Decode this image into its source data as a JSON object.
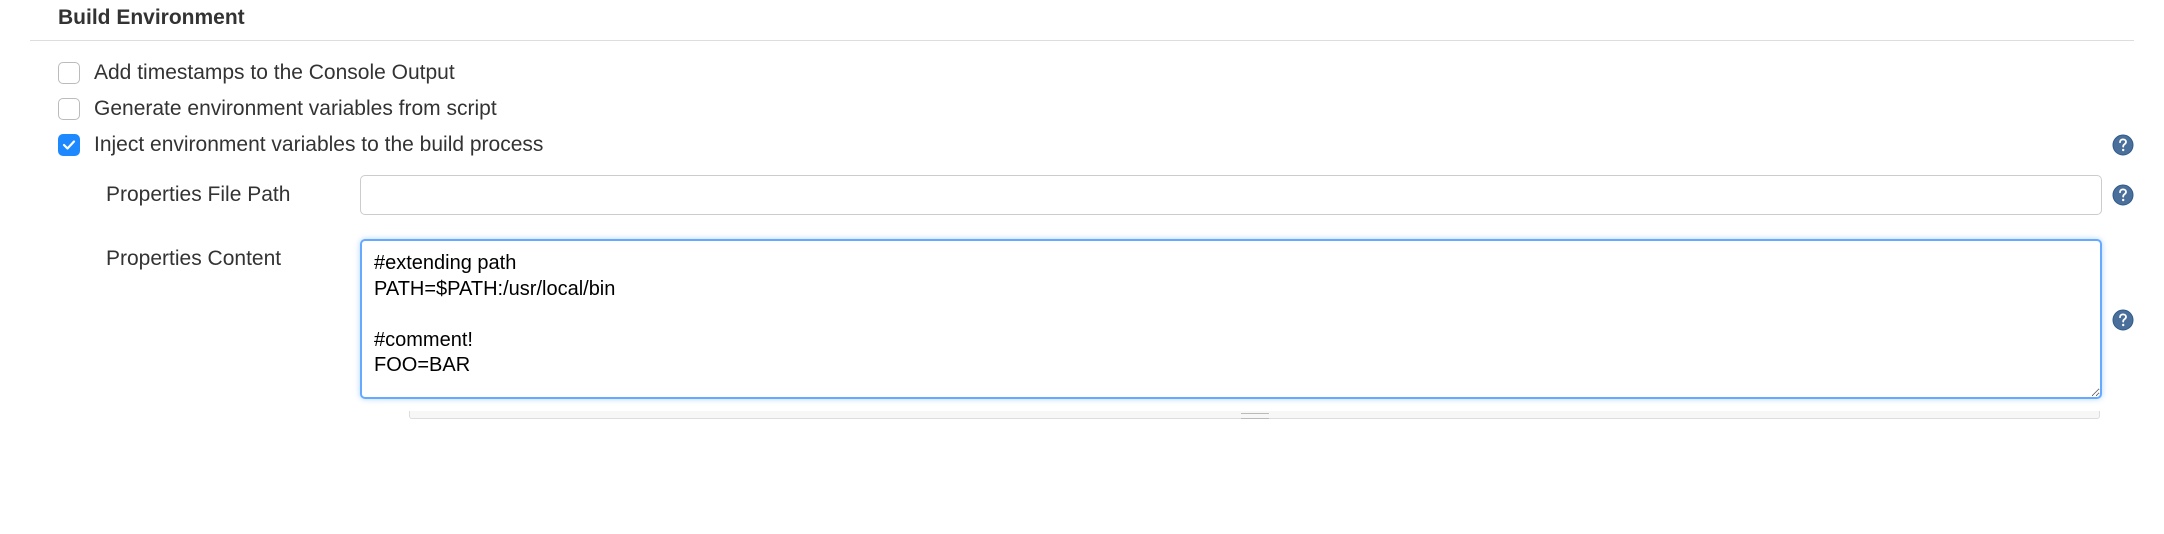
{
  "section": {
    "title": "Build Environment"
  },
  "options": {
    "timestamps": {
      "label": "Add timestamps to the Console Output",
      "checked": false
    },
    "generateEnv": {
      "label": "Generate environment variables from script",
      "checked": false
    },
    "injectEnv": {
      "label": "Inject environment variables to the build process",
      "checked": true
    }
  },
  "fields": {
    "propertiesFilePath": {
      "label": "Properties File Path",
      "value": ""
    },
    "propertiesContent": {
      "label": "Properties Content",
      "value": "#extending path\nPATH=$PATH:/usr/local/bin\n\n#comment!\nFOO=BAR"
    }
  }
}
